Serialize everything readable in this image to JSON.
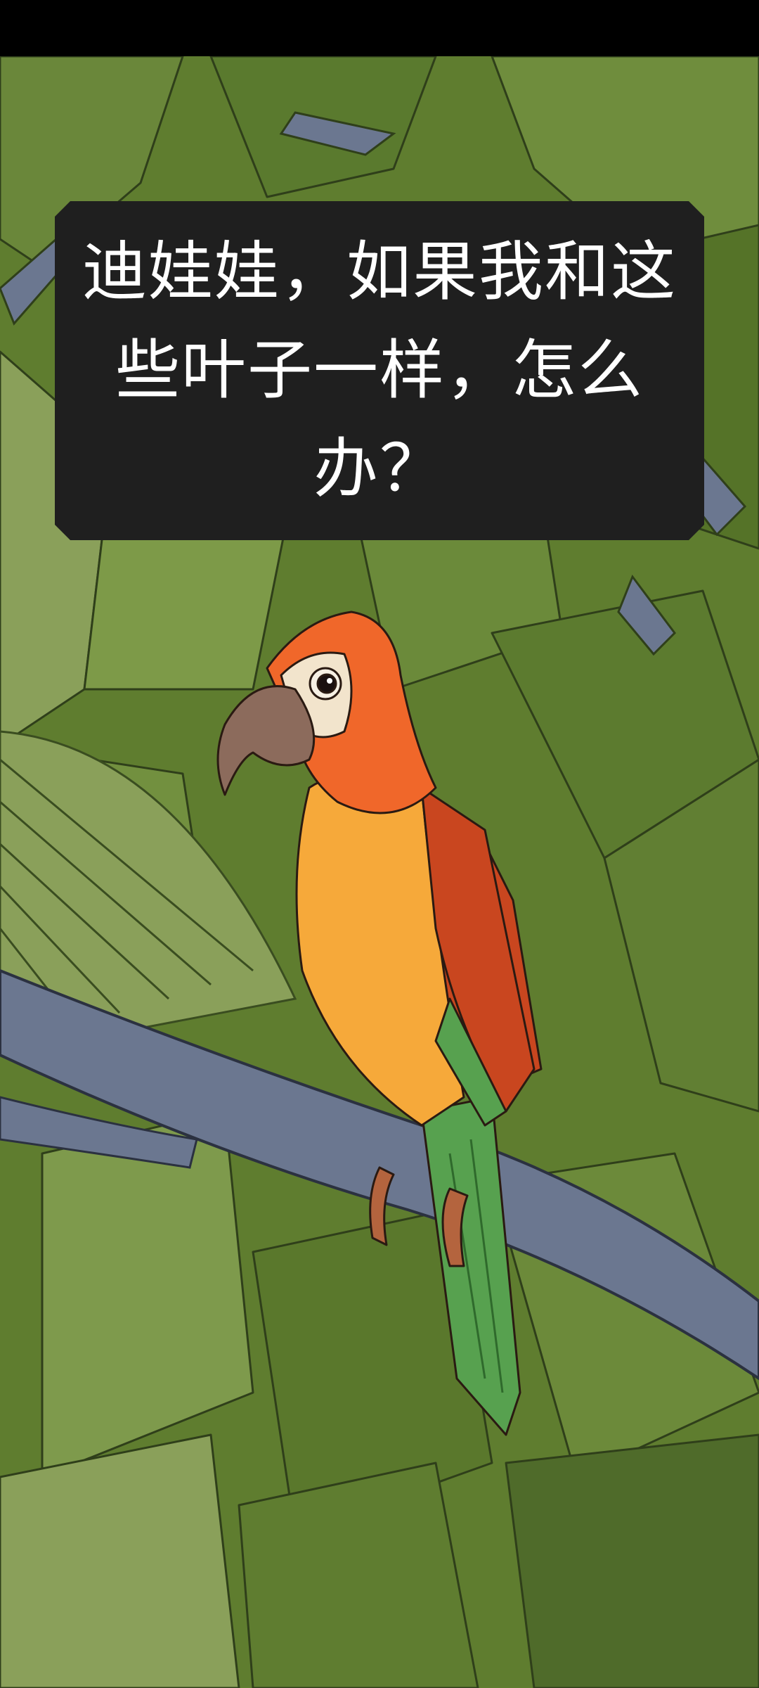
{
  "dialog": {
    "text": "迪娃娃，如果我和这些叶子一样，怎么办？"
  },
  "scene": {
    "background": "jungle-foliage",
    "character": "parrot",
    "colors": {
      "foliage_dark": "#4f6b2a",
      "foliage_mid": "#66843a",
      "foliage_light": "#8aa05a",
      "branch": "#6b7790",
      "parrot_head": "#f0672a",
      "parrot_body": "#f6a93a",
      "parrot_wing": "#c9461f",
      "parrot_tail": "#57a14f",
      "beak": "#8c6b5c",
      "dialog_bg": "#1f1f1f"
    }
  }
}
